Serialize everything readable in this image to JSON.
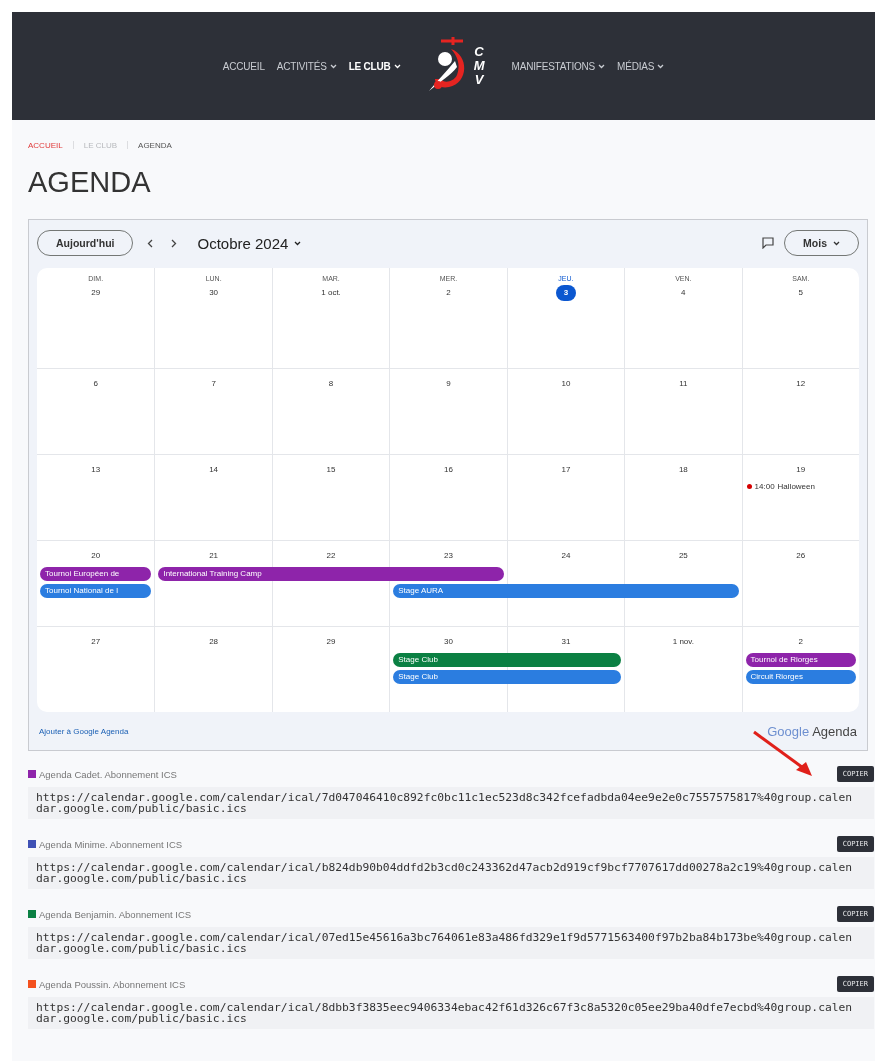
{
  "nav": {
    "left": [
      {
        "label": "ACCUEIL",
        "dropdown": false,
        "selected": false
      },
      {
        "label": "ACTIVITÉS",
        "dropdown": true,
        "selected": false
      },
      {
        "label": "LE CLUB",
        "dropdown": true,
        "selected": true
      }
    ],
    "logo_text": "CMV",
    "right": [
      {
        "label": "MANIFESTATIONS",
        "dropdown": true,
        "selected": false
      },
      {
        "label": "MÉDIAS",
        "dropdown": true,
        "selected": false
      }
    ]
  },
  "breadcrumb": [
    {
      "label": "ACCUEIL",
      "kind": "link"
    },
    {
      "label": "LE CLUB",
      "kind": "link"
    },
    {
      "label": "AGENDA",
      "kind": "current"
    }
  ],
  "title": "AGENDA",
  "calendar": {
    "today_button": "Aujourd'hui",
    "month": "Octobre 2024",
    "view": "Mois",
    "weekdays": [
      {
        "label": "DIM.",
        "today": false
      },
      {
        "label": "LUN.",
        "today": false
      },
      {
        "label": "MAR.",
        "today": false
      },
      {
        "label": "MER.",
        "today": false
      },
      {
        "label": "JEU.",
        "today": true
      },
      {
        "label": "VEN.",
        "today": false
      },
      {
        "label": "SAM.",
        "today": false
      }
    ],
    "weeks": [
      {
        "days": [
          {
            "label": "29",
            "today": false
          },
          {
            "label": "30",
            "today": false
          },
          {
            "label": "1 oct.",
            "today": false
          },
          {
            "label": "2",
            "today": false
          },
          {
            "label": "3",
            "today": true
          },
          {
            "label": "4",
            "today": false
          },
          {
            "label": "5",
            "today": false
          }
        ]
      },
      {
        "days": [
          {
            "label": "6",
            "today": false
          },
          {
            "label": "7",
            "today": false
          },
          {
            "label": "8",
            "today": false
          },
          {
            "label": "9",
            "today": false
          },
          {
            "label": "10",
            "today": false
          },
          {
            "label": "11",
            "today": false
          },
          {
            "label": "12",
            "today": false
          }
        ]
      },
      {
        "days": [
          {
            "label": "13",
            "today": false
          },
          {
            "label": "14",
            "today": false
          },
          {
            "label": "15",
            "today": false
          },
          {
            "label": "16",
            "today": false
          },
          {
            "label": "17",
            "today": false
          },
          {
            "label": "18",
            "today": false
          },
          {
            "label": "19",
            "today": false,
            "events": [
              {
                "kind": "dot",
                "time": "14:00",
                "title": "Halloween",
                "color": "#d50000"
              }
            ]
          }
        ]
      },
      {
        "days": [
          {
            "label": "20",
            "today": false,
            "events": [
              {
                "kind": "bar",
                "title": "Tournoi Européen de",
                "color": "#8e24aa"
              },
              {
                "kind": "bar",
                "title": "Tournoi National de l",
                "color": "#2b7de0"
              }
            ]
          },
          {
            "label": "21",
            "today": false,
            "events": [
              {
                "kind": "bar",
                "title": "International Training Camp",
                "color": "#8e24aa"
              }
            ]
          },
          {
            "label": "22",
            "today": false,
            "events": [
              {
                "kind": "bar",
                "color": "#8e24aa"
              }
            ]
          },
          {
            "label": "23",
            "today": false,
            "events": [
              {
                "kind": "bar",
                "color": "#8e24aa"
              },
              {
                "kind": "bar",
                "title": "Stage AURA",
                "color": "#2b7de0"
              }
            ]
          },
          {
            "label": "24",
            "today": false,
            "events": [
              {
                "kind": "gap"
              },
              {
                "kind": "bar",
                "color": "#2b7de0"
              }
            ]
          },
          {
            "label": "25",
            "today": false,
            "events": [
              {
                "kind": "gap"
              },
              {
                "kind": "bar",
                "color": "#2b7de0"
              }
            ]
          },
          {
            "label": "26",
            "today": false
          }
        ]
      },
      {
        "days": [
          {
            "label": "27",
            "today": false
          },
          {
            "label": "28",
            "today": false
          },
          {
            "label": "29",
            "today": false
          },
          {
            "label": "30",
            "today": false,
            "events": [
              {
                "kind": "bar",
                "title": "Stage Club",
                "color": "#0b8043"
              },
              {
                "kind": "bar",
                "title": "Stage Club",
                "color": "#2b7de0"
              }
            ]
          },
          {
            "label": "31",
            "today": false,
            "events": [
              {
                "kind": "bar",
                "color": "#0b8043"
              },
              {
                "kind": "bar",
                "color": "#2b7de0"
              }
            ]
          },
          {
            "label": "1 nov.",
            "today": false
          },
          {
            "label": "2",
            "today": false,
            "events": [
              {
                "kind": "bar",
                "title": "Tournoi de Riorges",
                "color": "#8e24aa"
              },
              {
                "kind": "bar",
                "title": "Circuit Riorges",
                "color": "#2b7de0"
              }
            ]
          }
        ]
      }
    ],
    "add_link": "Ajouter à Google Agenda",
    "brand": "Google",
    "brand_suffix": "Agenda"
  },
  "subscriptions": [
    {
      "label": "Agenda Cadet. Abonnement ICS",
      "color": "#8e24aa",
      "button": "COPIER",
      "url": "https://calendar.google.com/calendar/ical/7d047046410c892fc0bc11c1ec523d8c342fcefadbda04ee9e2e0c7557575817%40group.calendar.google.com/public/basic.ics"
    },
    {
      "label": "Agenda Minime. Abonnement ICS",
      "color": "#3f51b5",
      "button": "COPIER",
      "url": "https://calendar.google.com/calendar/ical/b824db90b04ddfd2b3cd0c243362d47acb2d919cf9bcf7707617dd00278a2c19%40group.calendar.google.com/public/basic.ics"
    },
    {
      "label": "Agenda Benjamin. Abonnement ICS",
      "color": "#0b8043",
      "button": "COPIER",
      "url": "https://calendar.google.com/calendar/ical/07ed15e45616a3bc764061e83a486fd329e1f9d5771563400f97b2ba84b173be%40group.calendar.google.com/public/basic.ics"
    },
    {
      "label": "Agenda Poussin. Abonnement ICS",
      "color": "#f4511e",
      "button": "COPIER",
      "url": "https://calendar.google.com/calendar/ical/8dbb3f3835eec9406334ebac42f61d326c67f3c8a5320c05ee29ba40dfe7ecbd%40group.calendar.google.com/public/basic.ics"
    }
  ]
}
